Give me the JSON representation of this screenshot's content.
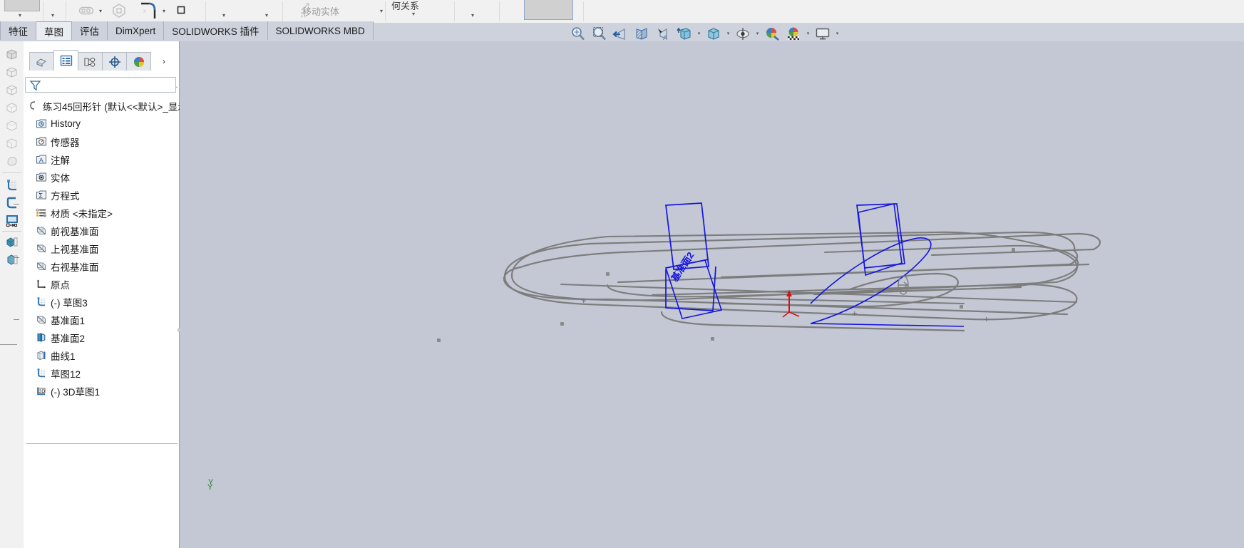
{
  "window": {
    "app": "SOLIDWORKS"
  },
  "command_bar": {
    "labels": {
      "move_entities": "移动实体",
      "relations": "何关系"
    },
    "icons": [
      {
        "name": "linear-pattern-icon"
      },
      {
        "name": "polygon-icon"
      },
      {
        "name": "fillet-icon"
      },
      {
        "name": "rectangle-icon"
      }
    ],
    "dropdown_glyph": "▾"
  },
  "tabs": [
    {
      "label": "特征",
      "name": "tab-features",
      "active": false
    },
    {
      "label": "草图",
      "name": "tab-sketch",
      "active": true
    },
    {
      "label": "评估",
      "name": "tab-evaluate",
      "active": false
    },
    {
      "label": "DimXpert",
      "name": "tab-dimxpert",
      "active": false
    },
    {
      "label": "SOLIDWORKS 插件",
      "name": "tab-solidworks-addins",
      "active": false
    },
    {
      "label": "SOLIDWORKS MBD",
      "name": "tab-solidworks-mbd",
      "active": false
    }
  ],
  "view_toolbar": [
    {
      "name": "zoom-to-fit-icon",
      "has_dropdown": false
    },
    {
      "name": "zoom-to-area-icon",
      "has_dropdown": false
    },
    {
      "name": "previous-view-icon",
      "has_dropdown": false
    },
    {
      "name": "section-view-icon",
      "has_dropdown": false
    },
    {
      "name": "view-orientation-icon",
      "has_dropdown": false
    },
    {
      "name": "display-style-icon",
      "has_dropdown": true
    },
    {
      "name": "hide-show-items-icon",
      "has_dropdown": true
    },
    {
      "name": "view-settings-icon",
      "has_dropdown": true
    },
    {
      "name": "apply-scene-icon",
      "has_dropdown": false
    },
    {
      "name": "view-setting-scene-icon",
      "has_dropdown": true
    },
    {
      "name": "viewport-icon",
      "has_dropdown": true
    }
  ],
  "left_strip": [
    {
      "name": "part-icon-1"
    },
    {
      "name": "part-icon-2"
    },
    {
      "name": "part-icon-3"
    },
    {
      "name": "part-icon-4"
    },
    {
      "name": "part-icon-5"
    },
    {
      "name": "part-icon-6"
    },
    {
      "name": "part-icon-7"
    },
    {
      "name": "sketch-new-icon"
    },
    {
      "name": "sketch-edit-icon"
    },
    {
      "name": "display-area-icon"
    },
    {
      "name": "appearance-icon"
    },
    {
      "name": "scene-icon"
    }
  ],
  "feature_manager": {
    "tabs": [
      {
        "name": "fm-tab-feature-tree",
        "icon": "feature-tree-icon",
        "selected": true
      },
      {
        "name": "fm-tab-property-manager",
        "icon": "property-manager-icon",
        "selected": false
      },
      {
        "name": "fm-tab-configuration-manager",
        "icon": "configuration-manager-icon",
        "selected": false
      },
      {
        "name": "fm-tab-dimxpert-manager",
        "icon": "dimxpert-manager-icon",
        "selected": false
      },
      {
        "name": "fm-tab-display-manager",
        "icon": "display-manager-icon",
        "selected": false
      }
    ],
    "more_tabs_glyph": "›",
    "filter": {
      "icon": "filter-icon",
      "value": "",
      "placeholder": ""
    },
    "root": {
      "label": "练习45回形针  (默认<<默认>_显示",
      "icon": "part-root-icon"
    },
    "tree": [
      {
        "label": "History",
        "icon": "history-icon",
        "indent": 1
      },
      {
        "label": "传感器",
        "icon": "sensors-icon",
        "indent": 1
      },
      {
        "label": "注解",
        "icon": "annotations-icon",
        "indent": 1
      },
      {
        "label": "实体",
        "icon": "solid-bodies-icon",
        "indent": 1
      },
      {
        "label": "方程式",
        "icon": "equations-icon",
        "indent": 1
      },
      {
        "label": "材质 <未指定>",
        "icon": "material-icon",
        "indent": 1
      },
      {
        "label": "前视基准面",
        "icon": "plane-icon",
        "indent": 1
      },
      {
        "label": "上视基准面",
        "icon": "plane-icon",
        "indent": 1
      },
      {
        "label": "右视基准面",
        "icon": "plane-icon",
        "indent": 1
      },
      {
        "label": "原点",
        "icon": "origin-icon",
        "indent": 1
      },
      {
        "label": "(-) 草图3",
        "icon": "sketch-icon",
        "indent": 1
      },
      {
        "label": "基准面1",
        "icon": "plane-icon",
        "indent": 1
      },
      {
        "label": "基准面2",
        "icon": "plane-highlight-icon",
        "indent": 1
      },
      {
        "label": "曲线1",
        "icon": "curve-icon",
        "indent": 1
      },
      {
        "label": "草图12",
        "icon": "sketch-icon",
        "indent": 1
      },
      {
        "label": "(-) 3D草图1",
        "icon": "sketch3d-icon",
        "indent": 1
      }
    ]
  },
  "graphics": {
    "background_color": "#c3c8d4",
    "plane_label": "基准面2",
    "plane_label_color": "#1414e0",
    "sketch_color": "#1414e0",
    "curve_color": "#7d7d7d",
    "origin_color": "#e01010",
    "axis_label_y": "Y"
  }
}
